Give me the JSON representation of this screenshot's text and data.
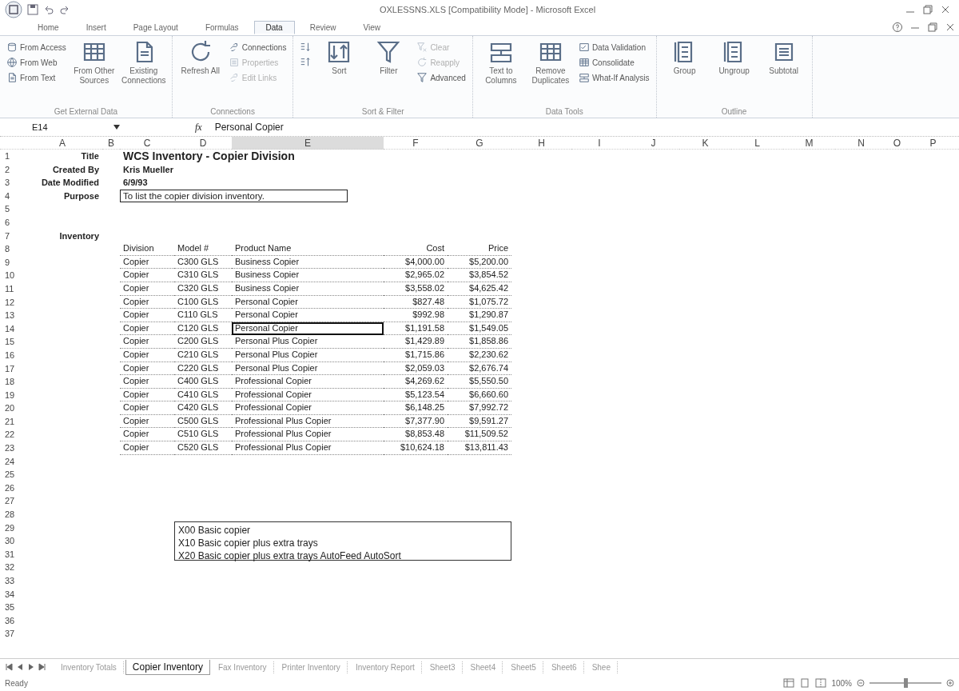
{
  "window": {
    "title": "OXLESSNS.XLS  [Compatibility Mode] - Microsoft Excel"
  },
  "ribbon": {
    "tabs": [
      {
        "label": "Home",
        "selected": false
      },
      {
        "label": "Insert",
        "selected": false
      },
      {
        "label": "Page Layout",
        "selected": false
      },
      {
        "label": "Formulas",
        "selected": false
      },
      {
        "label": "Data",
        "selected": true
      },
      {
        "label": "Review",
        "selected": false
      },
      {
        "label": "View",
        "selected": false
      }
    ],
    "groups": [
      {
        "label": "Get External Data",
        "columns": [
          {
            "kind": "stack",
            "items": [
              {
                "label": "From Access",
                "disabled": false
              },
              {
                "label": "From Web",
                "disabled": false
              },
              {
                "label": "From Text",
                "disabled": false
              }
            ]
          },
          {
            "kind": "large",
            "label": "From Other Sources"
          },
          {
            "kind": "large",
            "label": "Existing Connections"
          }
        ]
      },
      {
        "label": "Connections",
        "columns": [
          {
            "kind": "large",
            "label": "Refresh All"
          },
          {
            "kind": "stack",
            "items": [
              {
                "label": "Connections",
                "disabled": false
              },
              {
                "label": "Properties",
                "disabled": true
              },
              {
                "label": "Edit Links",
                "disabled": true
              }
            ]
          }
        ]
      },
      {
        "label": "Sort & Filter",
        "columns": [
          {
            "kind": "stack",
            "items": [
              {
                "disabled": false
              },
              {
                "disabled": false
              }
            ]
          },
          {
            "kind": "large",
            "label": "Sort"
          },
          {
            "kind": "large",
            "label": "Filter"
          },
          {
            "kind": "stack",
            "items": [
              {
                "label": "Clear",
                "disabled": true
              },
              {
                "label": "Reapply",
                "disabled": true
              },
              {
                "label": "Advanced",
                "disabled": false
              }
            ]
          }
        ]
      },
      {
        "label": "Data Tools",
        "columns": [
          {
            "kind": "large",
            "label": "Text to Columns"
          },
          {
            "kind": "large",
            "label": "Remove Duplicates"
          },
          {
            "kind": "stack",
            "items": [
              {
                "label": "Data Validation",
                "disabled": false
              },
              {
                "label": "Consolidate",
                "disabled": false
              },
              {
                "label": "What-If Analysis",
                "disabled": false
              }
            ]
          }
        ]
      },
      {
        "label": "Outline",
        "columns": [
          {
            "kind": "large",
            "label": "Group"
          },
          {
            "kind": "large",
            "label": "Ungroup"
          },
          {
            "kind": "large",
            "label": "Subtotal"
          }
        ]
      }
    ]
  },
  "formula_bar": {
    "name_box": "E14",
    "fx_label": "fx",
    "formula": "Personal Copier"
  },
  "sheet": {
    "columns": [
      {
        "label": "A",
        "selected": false
      },
      {
        "label": "B",
        "selected": false
      },
      {
        "label": "C",
        "selected": false
      },
      {
        "label": "D",
        "selected": false
      },
      {
        "label": "E",
        "selected": true
      },
      {
        "label": "F",
        "selected": false
      },
      {
        "label": "G",
        "selected": false
      },
      {
        "label": "H",
        "selected": false
      },
      {
        "label": "I",
        "selected": false
      },
      {
        "label": "J",
        "selected": false
      },
      {
        "label": "K",
        "selected": false
      },
      {
        "label": "L",
        "selected": false
      },
      {
        "label": "M",
        "selected": false
      },
      {
        "label": "N",
        "selected": false
      },
      {
        "label": "O",
        "selected": false
      },
      {
        "label": "P",
        "selected": false
      }
    ],
    "row_numbers": [
      "1",
      "2",
      "3",
      "4",
      "5",
      "6",
      "7",
      "8",
      "9",
      "10",
      "11",
      "12",
      "13",
      "14",
      "15",
      "16",
      "17",
      "18",
      "19",
      "20",
      "21",
      "22",
      "23",
      "24",
      "25",
      "26",
      "27",
      "28",
      "29",
      "30",
      "31",
      "32",
      "33",
      "34",
      "35",
      "36",
      "37"
    ],
    "header_fields": [
      {
        "label": "Title",
        "value": "WCS Inventory - Copier Division",
        "kind": "title"
      },
      {
        "label": "Created By",
        "value": "Kris Mueller",
        "kind": "text"
      },
      {
        "label": "Date Modified",
        "value": "6/9/93",
        "kind": "text"
      },
      {
        "label": "Purpose",
        "value": "To list the  copier division inventory.",
        "kind": "boxed"
      }
    ],
    "section_label": "Inventory",
    "table": {
      "columns": [
        "Division",
        "Model #",
        "Product Name",
        "Cost",
        "Price"
      ],
      "rows": [
        {
          "cells": [
            "Copier",
            "C300 GLS",
            "Business Copier",
            "$4,000.00",
            "$5,200.00"
          ],
          "active": false
        },
        {
          "cells": [
            "Copier",
            "C310 GLS",
            "Business Copier",
            "$2,965.02",
            "$3,854.52"
          ],
          "active": false
        },
        {
          "cells": [
            "Copier",
            "C320 GLS",
            "Business Copier",
            "$3,558.02",
            "$4,625.42"
          ],
          "active": false
        },
        {
          "cells": [
            "Copier",
            "C100 GLS",
            "Personal Copier",
            "$827.48",
            "$1,075.72"
          ],
          "active": false
        },
        {
          "cells": [
            "Copier",
            "C110 GLS",
            "Personal Copier",
            "$992.98",
            "$1,290.87"
          ],
          "active": false
        },
        {
          "cells": [
            "Copier",
            "C120 GLS",
            "Personal Copier",
            "$1,191.58",
            "$1,549.05"
          ],
          "active": true
        },
        {
          "cells": [
            "Copier",
            "C200 GLS",
            "Personal Plus Copier",
            "$1,429.89",
            "$1,858.86"
          ],
          "active": false
        },
        {
          "cells": [
            "Copier",
            "C210 GLS",
            "Personal Plus Copier",
            "$1,715.86",
            "$2,230.62"
          ],
          "active": false
        },
        {
          "cells": [
            "Copier",
            "C220 GLS",
            "Personal Plus Copier",
            "$2,059.03",
            "$2,676.74"
          ],
          "active": false
        },
        {
          "cells": [
            "Copier",
            "C400 GLS",
            "Professional Copier",
            "$4,269.62",
            "$5,550.50"
          ],
          "active": false
        },
        {
          "cells": [
            "Copier",
            "C410 GLS",
            "Professional Copier",
            "$5,123.54",
            "$6,660.60"
          ],
          "active": false
        },
        {
          "cells": [
            "Copier",
            "C420 GLS",
            "Professional Copier",
            "$6,148.25",
            "$7,992.72"
          ],
          "active": false
        },
        {
          "cells": [
            "Copier",
            "C500 GLS",
            "Professional Plus Copier",
            "$7,377.90",
            "$9,591.27"
          ],
          "active": false
        },
        {
          "cells": [
            "Copier",
            "C510 GLS",
            "Professional Plus Copier",
            "$8,853.48",
            "$11,509.52"
          ],
          "active": false
        },
        {
          "cells": [
            "Copier",
            "C520 GLS",
            "Professional Plus Copier",
            "$10,624.18",
            "$13,811.43"
          ],
          "active": false
        }
      ]
    },
    "notes": [
      "X00  Basic copier",
      "X10  Basic copier plus extra trays",
      "X20  Basic copier plus extra trays  AutoFeed  AutoSort"
    ]
  },
  "sheet_tabs": [
    {
      "label": "Inventory Totals",
      "selected": false
    },
    {
      "label": "Copier Inventory",
      "selected": true
    },
    {
      "label": "Fax Inventory",
      "selected": false
    },
    {
      "label": "Printer Inventory",
      "selected": false
    },
    {
      "label": "Inventory Report",
      "selected": false
    },
    {
      "label": "Sheet3",
      "selected": false
    },
    {
      "label": "Sheet4",
      "selected": false
    },
    {
      "label": "Sheet5",
      "selected": false
    },
    {
      "label": "Sheet6",
      "selected": false
    },
    {
      "label": "Shee",
      "selected": false
    }
  ],
  "status_bar": {
    "status": "Ready",
    "zoom": {
      "reading": "100%",
      "level": 0.5
    }
  }
}
